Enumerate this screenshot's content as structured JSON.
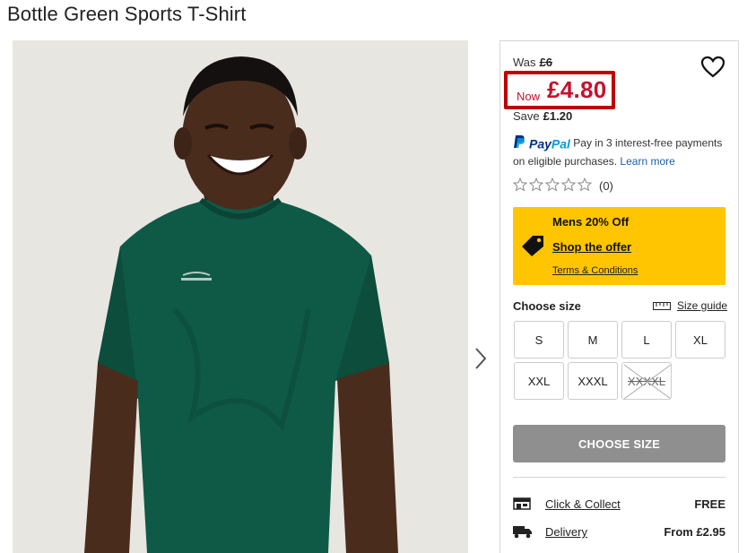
{
  "product": {
    "title": "Bottle Green Sports T-Shirt"
  },
  "price": {
    "was_label": "Was",
    "was_value": "£6",
    "now_label": "Now",
    "now_value": "£4.80",
    "save_label": "Save",
    "save_value": "£1.20"
  },
  "paypal": {
    "brand_pay": "Pay",
    "brand_pal": "Pal",
    "text": "Pay in 3 interest-free payments on eligible purchases.",
    "learn_more": "Learn more"
  },
  "rating": {
    "stars": 0,
    "max_stars": 5,
    "count": "(0)"
  },
  "promo": {
    "title": "Mens 20% Off",
    "link": "Shop the offer",
    "terms": "Terms & Conditions",
    "color": "#ffc500"
  },
  "size": {
    "label": "Choose size",
    "guide": "Size guide",
    "options": [
      {
        "label": "S",
        "available": true
      },
      {
        "label": "M",
        "available": true
      },
      {
        "label": "L",
        "available": true
      },
      {
        "label": "XL",
        "available": true
      },
      {
        "label": "XXL",
        "available": true
      },
      {
        "label": "XXXL",
        "available": true
      },
      {
        "label": "XXXXL",
        "available": false
      }
    ]
  },
  "cta": {
    "choose_size": "CHOOSE SIZE"
  },
  "delivery": {
    "click_collect_label": "Click & Collect",
    "click_collect_value": "FREE",
    "delivery_label": "Delivery",
    "delivery_value": "From £2.95"
  },
  "icons": {
    "wishlist": "heart-icon",
    "next": "chevron-right-icon",
    "promo": "price-tag-icon",
    "size_guide": "ruler-icon",
    "click_collect": "store-icon",
    "delivery": "truck-icon"
  },
  "colors": {
    "sale_red": "#c8102e",
    "highlight_border": "#c00000",
    "cta_disabled": "#8f8f8f",
    "shirt_green": "#0f5a46"
  }
}
